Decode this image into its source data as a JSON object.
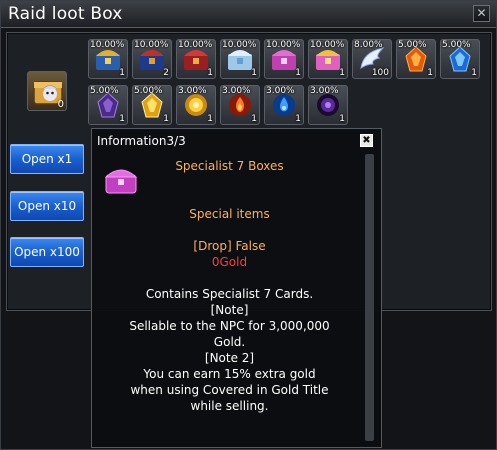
{
  "window": {
    "title": "Raid loot Box",
    "close_glyph": "✕"
  },
  "box": {
    "count": "0",
    "icon": "raid-box-icon"
  },
  "buttons": [
    {
      "label": "Open x1"
    },
    {
      "label": "Open x10"
    },
    {
      "label": "Open x100"
    }
  ],
  "items": [
    {
      "pct": "10.00%",
      "qty": "1",
      "art": "gold-blue-chest"
    },
    {
      "pct": "10.00%",
      "qty": "2",
      "art": "red-blue-chest"
    },
    {
      "pct": "10.00%",
      "qty": "1",
      "art": "red-chest"
    },
    {
      "pct": "10.00%",
      "qty": "1",
      "art": "ice-chest"
    },
    {
      "pct": "10.00%",
      "qty": "1",
      "art": "pink-chest"
    },
    {
      "pct": "10.00%",
      "qty": "1",
      "art": "pink-gold-chest"
    },
    {
      "pct": "8.00%",
      "qty": "100",
      "art": "silver-wing"
    },
    {
      "pct": "5.00%",
      "qty": "1",
      "art": "fire-stone"
    },
    {
      "pct": "5.00%",
      "qty": "1",
      "art": "water-stone"
    },
    {
      "pct": "5.00%",
      "qty": "1",
      "art": "dark-stone"
    },
    {
      "pct": "5.00%",
      "qty": "1",
      "art": "light-stone"
    },
    {
      "pct": "3.00%",
      "qty": "1",
      "art": "light-orb"
    },
    {
      "pct": "3.00%",
      "qty": "1",
      "art": "fire-orb"
    },
    {
      "pct": "3.00%",
      "qty": "1",
      "art": "water-orb"
    },
    {
      "pct": "3.00%",
      "qty": "1",
      "art": "dark-orb"
    }
  ],
  "tooltip": {
    "title": "Information3/3",
    "close_glyph": "✖",
    "item_name": "Specialist 7 Boxes",
    "category": "Special items",
    "drop": "[Drop] False",
    "gold": "0Gold",
    "desc_1": "Contains Specialist 7 Cards.",
    "note": "[Note]",
    "desc_2": "Sellable to the NPC for 3,000,000",
    "desc_3": "Gold.",
    "note_2": "[Note 2]",
    "desc_4": "You can earn 15% extra gold",
    "desc_5": "when using Covered in Gold Title",
    "desc_6": "while selling."
  },
  "colors": {
    "accent_orange": "#ffb15a",
    "error_red": "#ff3b3b",
    "button_blue": "#1a5fd0"
  }
}
